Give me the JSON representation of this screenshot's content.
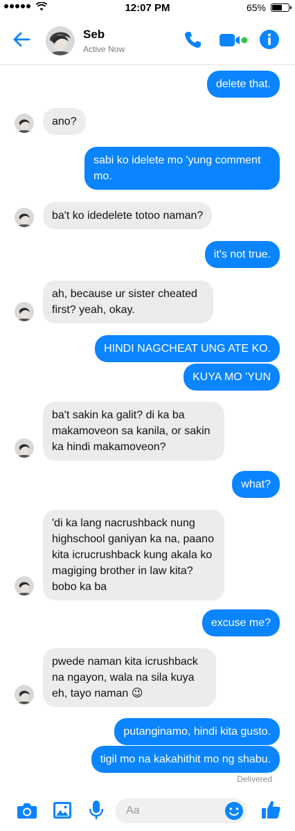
{
  "status_bar": {
    "time": "12:07 PM",
    "battery_percent": "65%",
    "battery_level": 0.65
  },
  "header": {
    "name": "Seb",
    "status": "Active Now"
  },
  "messages": [
    {
      "dir": "out",
      "text": "delete that."
    },
    {
      "dir": "in",
      "text": "ano?"
    },
    {
      "dir": "out",
      "text": "sabi ko idelete mo 'yung comment mo."
    },
    {
      "dir": "in",
      "text": "ba't ko idedelete totoo naman?"
    },
    {
      "dir": "out",
      "text": "it's not true."
    },
    {
      "dir": "in",
      "text": "ah, because ur sister cheated first? yeah, okay."
    },
    {
      "dir": "out",
      "text": "HINDI NAGCHEAT UNG ATE KO."
    },
    {
      "dir": "out",
      "text": "KUYA MO 'YUN"
    },
    {
      "dir": "in",
      "text": "ba't sakin ka galit? di ka ba makamoveon sa kanila, or sakin ka hindi makamoveon?"
    },
    {
      "dir": "out",
      "text": "what?"
    },
    {
      "dir": "in",
      "text": "'di ka lang nacrushback nung highschool ganiyan ka na, paano kita icrucrushback kung akala ko magiging brother in law kita? bobo ka ba"
    },
    {
      "dir": "out",
      "text": "excuse me?"
    },
    {
      "dir": "in",
      "text": "pwede naman kita icrushback na ngayon, wala na sila kuya eh, tayo naman 😉"
    },
    {
      "dir": "out",
      "text": "putanginamo, hindi kita gusto."
    },
    {
      "dir": "out",
      "text": "tigil mo na kakahithit mo ng shabu."
    }
  ],
  "delivery_status": "Delivered",
  "composer": {
    "placeholder": "Aa"
  },
  "icons": {
    "back": "back-arrow-icon",
    "call": "phone-icon",
    "video": "video-camera-icon",
    "info": "info-icon",
    "camera": "camera-icon",
    "gallery": "image-icon",
    "mic": "microphone-icon",
    "emoji": "smiley-icon",
    "like": "thumbs-up-icon"
  },
  "colors": {
    "accent": "#0a84ff",
    "incoming_bubble": "#ececee",
    "online": "#31c24d"
  }
}
